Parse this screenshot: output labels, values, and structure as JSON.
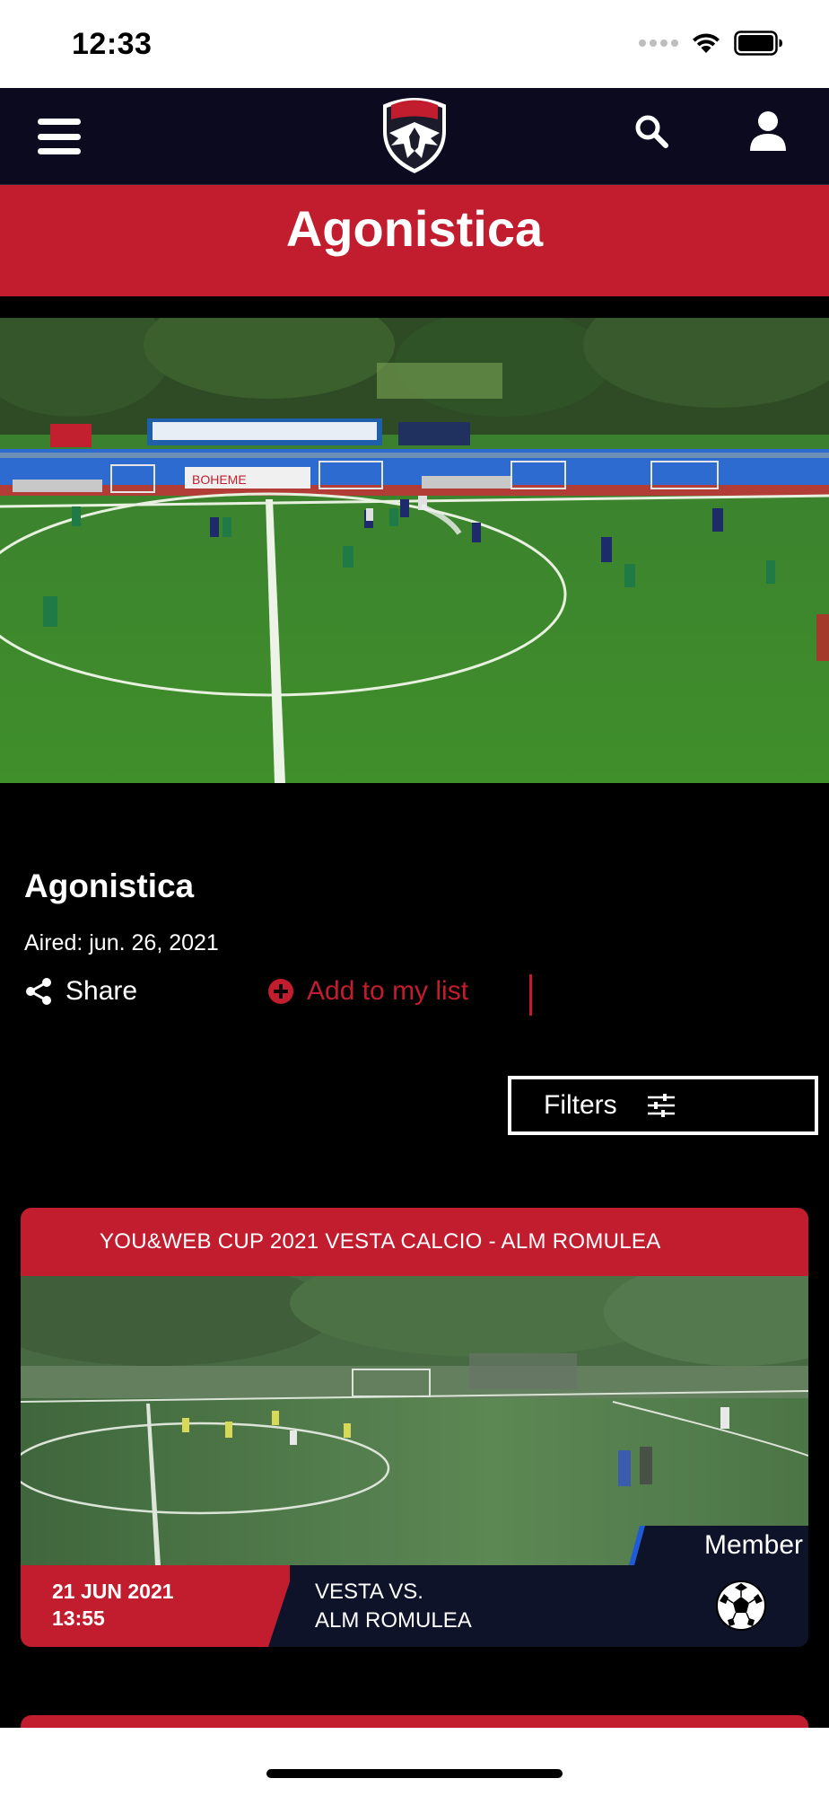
{
  "status_bar": {
    "time": "12:33"
  },
  "nav": {
    "menu_icon": "hamburger-menu-icon",
    "logo_alt": "FOOTBALL CLUB ISLE OF MAN",
    "search_icon": "search-icon",
    "user_icon": "user-icon"
  },
  "page": {
    "title": "Agonistica"
  },
  "video": {
    "title": "Agonistica",
    "aired": "Aired: jun. 26, 2021",
    "share_label": "Share",
    "add_list_label": "Add to my list"
  },
  "filters": {
    "label": "Filters"
  },
  "cards": [
    {
      "header": "YOU&WEB CUP 2021 VESTA CALCIO - ALM ROMULEA",
      "badge": "Member",
      "date": "21 JUN 2021",
      "time": "13:55",
      "title_line1": "VESTA VS.",
      "title_line2": "ALM ROMULEA",
      "sport_icon": "soccer-ball-icon"
    }
  ],
  "colors": {
    "brand_red": "#c11d2f",
    "nav_bg": "#0c0a1e",
    "background": "#000000"
  }
}
